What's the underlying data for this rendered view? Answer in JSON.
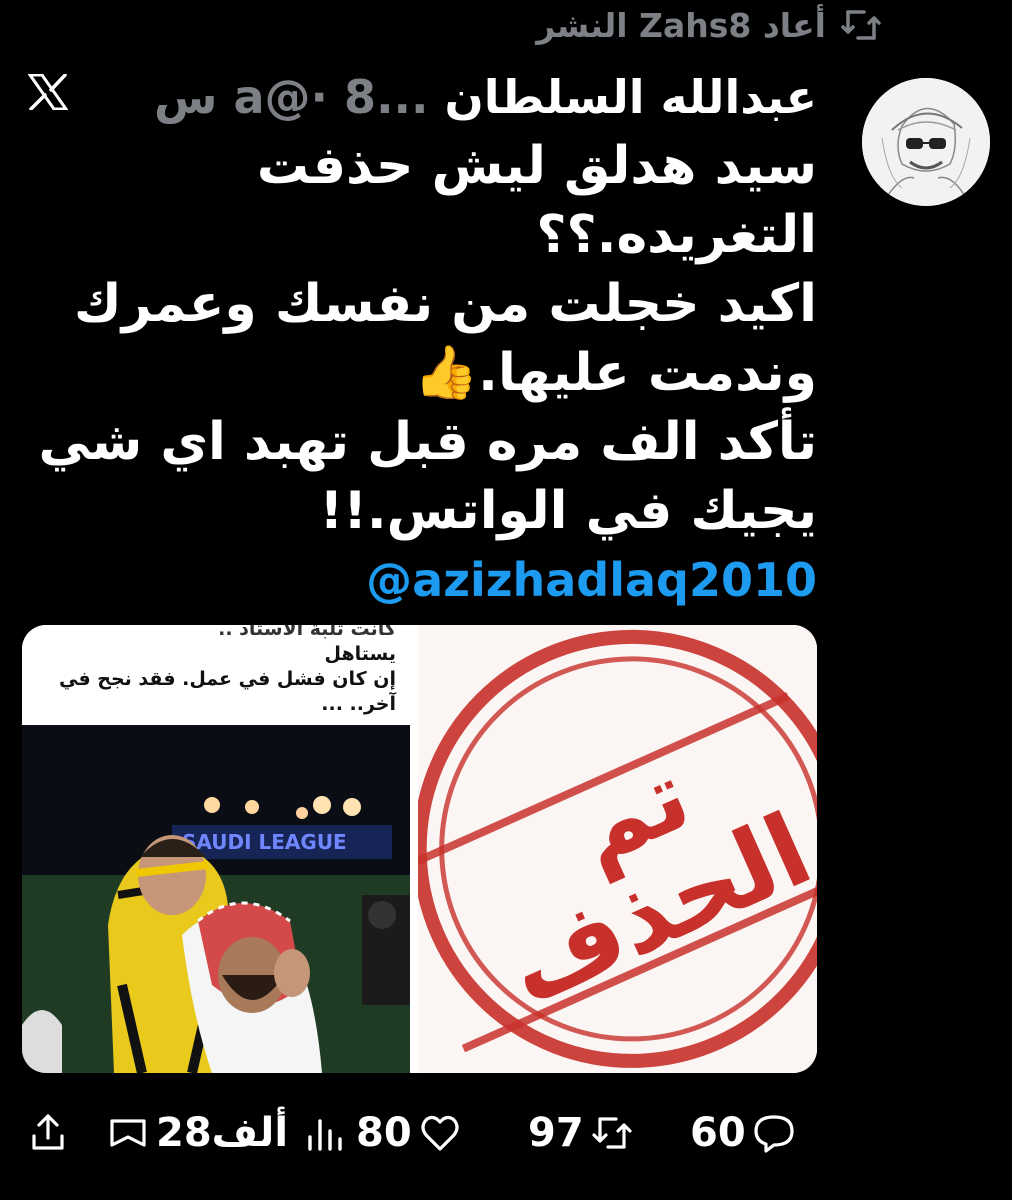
{
  "repost": {
    "text": "أعاد Zahs8 النشر"
  },
  "tweet": {
    "author_name": "عبدالله السلطان",
    "meta": " ...a@· 8 س",
    "lines": [
      "سيد هدلق ليش حذفت",
      "التغريده.؟؟",
      "اكيد خجلت من نفسك وعمرك",
      "وندمت عليها.👍",
      "تأكد الف مره قبل تهبد اي شي",
      "يجيك في الواتس.!!"
    ],
    "mention": "@azizhadlaq2010",
    "image_left_caption": {
      "cut_line": "كانت تلبة الاستاد ..",
      "lines": [
        "يستاهل",
        "إن كان فشل في عمل. فقد نجح في",
        "آخر.. ..."
      ]
    },
    "image_left_banner": "SAUDI LEAGUE",
    "image_right_stamp": [
      "تم",
      "الحذف"
    ]
  },
  "actions": {
    "replies": "60",
    "reposts": "97",
    "likes": "80",
    "views": "28ألف"
  },
  "colors": {
    "background": "#000000",
    "muted": "#7d8186",
    "link": "#1d9bf0",
    "stamp": "#c8312b"
  },
  "icons": [
    "repost-icon",
    "x-logo-icon",
    "reply-icon",
    "like-icon",
    "views-icon",
    "bookmark-icon",
    "share-icon"
  ]
}
